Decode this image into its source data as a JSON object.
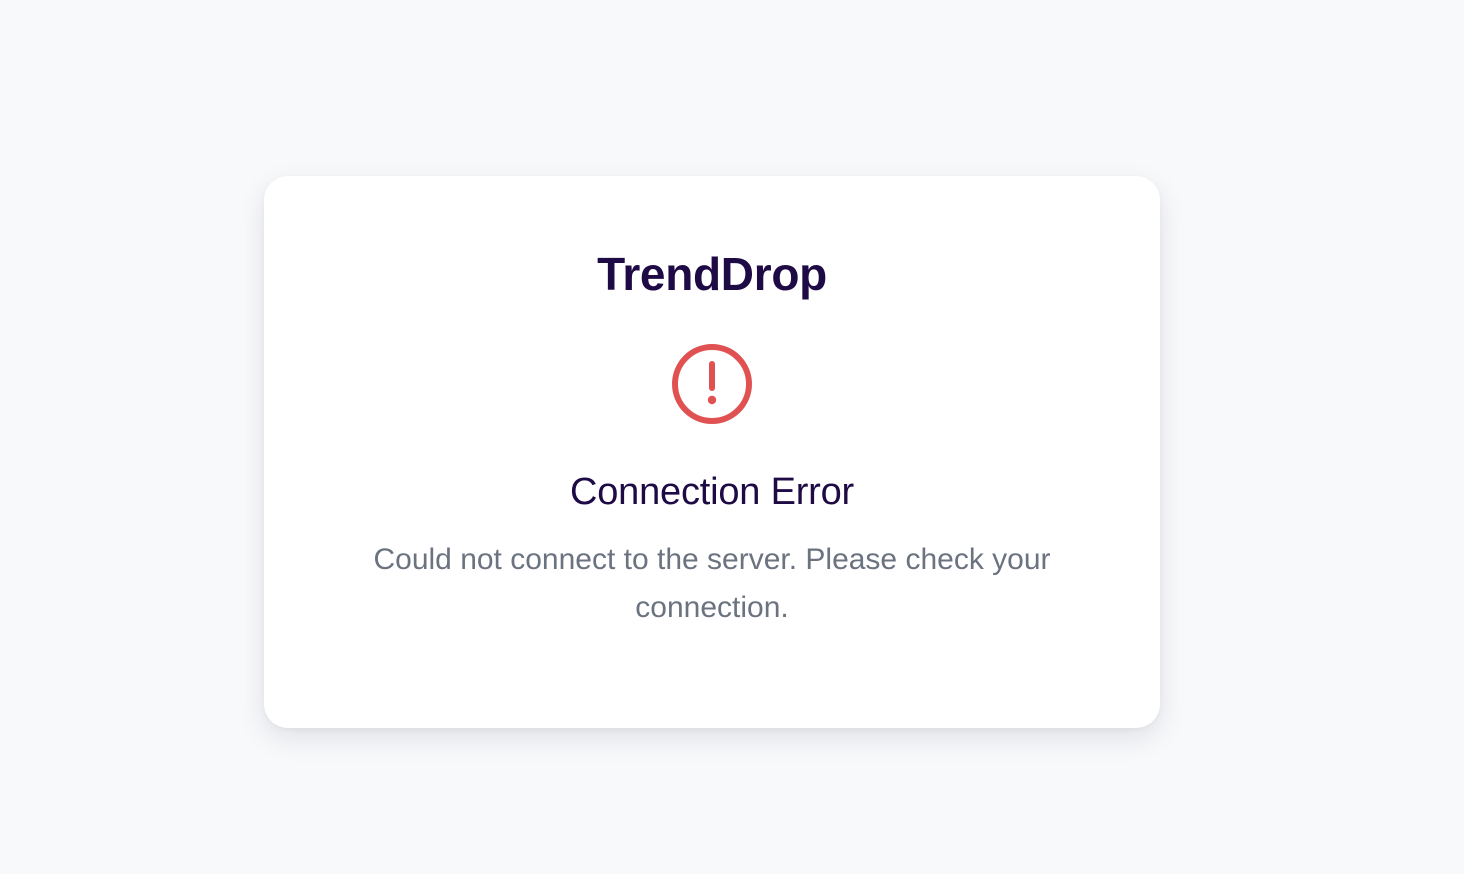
{
  "app": {
    "name": "TrendDrop"
  },
  "error": {
    "icon": "alert-circle-icon",
    "title": "Connection Error",
    "message": "Could not connect to the server. Please check your connection."
  },
  "colors": {
    "background": "#f8f9fb",
    "card": "#ffffff",
    "brand_text": "#1e0a45",
    "error_icon": "#e05252",
    "message_text": "#6b7280"
  }
}
